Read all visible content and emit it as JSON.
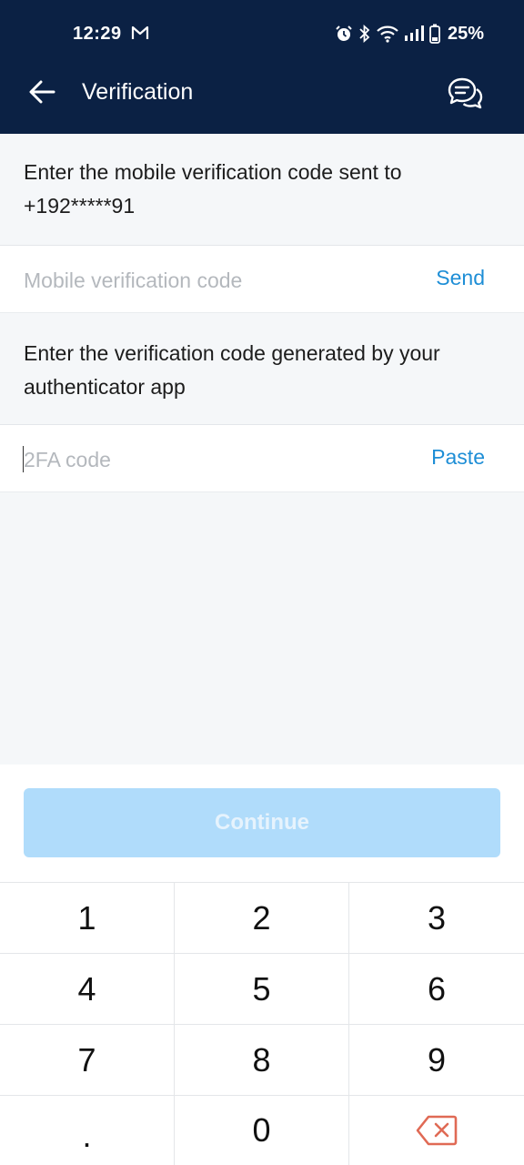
{
  "status_bar": {
    "time": "12:29",
    "battery": "25%",
    "icons": [
      "gmail-icon",
      "alarm-icon",
      "bluetooth-icon",
      "wifi-icon",
      "signal-icon",
      "battery-icon"
    ]
  },
  "app_bar": {
    "title": "Verification",
    "back_icon": "arrow-left-icon",
    "support_icon": "chat-bubbles-icon"
  },
  "mobile_section": {
    "instruction": "Enter the mobile verification code sent to +192*****91",
    "placeholder": "Mobile verification code",
    "value": "",
    "action_label": "Send"
  },
  "twofa_section": {
    "instruction": "Enter the verification code generated by your authenticator app",
    "placeholder": "2FA code",
    "value": "",
    "action_label": "Paste"
  },
  "continue_label": "Continue",
  "colors": {
    "header_bg": "#0b2144",
    "link": "#1e8ed6",
    "button_disabled": "#b0dcfb",
    "delete_icon": "#e06a55"
  },
  "keypad": {
    "keys": [
      "1",
      "2",
      "3",
      "4",
      "5",
      "6",
      "7",
      "8",
      "9",
      ".",
      "0"
    ],
    "delete_icon": "backspace-icon"
  }
}
